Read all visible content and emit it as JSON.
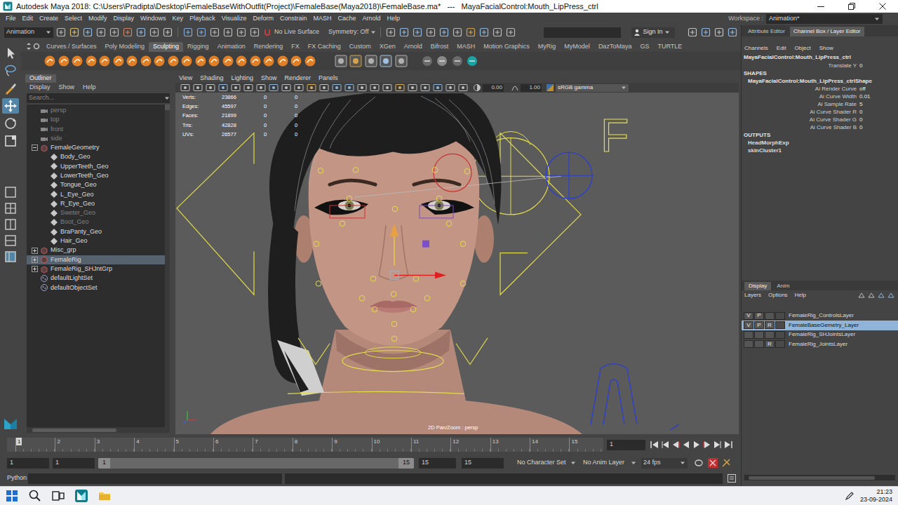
{
  "window": {
    "title": "Autodesk Maya 2018: C:\\Users\\Pradipta\\Desktop\\FemaleBaseWithOutfit(Project)\\FemaleBase(Maya2018)\\FemaleBase.ma*   ---   MayaFacialControl:Mouth_LipPress_ctrl"
  },
  "menu_bar": {
    "items": [
      "File",
      "Edit",
      "Create",
      "Select",
      "Modify",
      "Display",
      "Windows",
      "Key",
      "Playback",
      "Visualize",
      "Deform",
      "Constrain",
      "MASH",
      "Cache",
      "Arnold",
      "Help"
    ],
    "workspace_label": "Workspace :",
    "workspace": "Animation*"
  },
  "status_line": {
    "menu_set": "Animation",
    "live_surface": "No Live Surface",
    "symmetry": "Symmetry: Off",
    "sign_in": "Sign In"
  },
  "shelf": {
    "tabs": [
      {
        "label": "Curves / Surfaces",
        "selected": false
      },
      {
        "label": "Poly Modeling",
        "selected": false
      },
      {
        "label": "Sculpting",
        "selected": true
      },
      {
        "label": "Rigging",
        "selected": false
      },
      {
        "label": "Animation",
        "selected": false
      },
      {
        "label": "Rendering",
        "selected": false
      },
      {
        "label": "FX",
        "selected": false
      },
      {
        "label": "FX Caching",
        "selected": false
      },
      {
        "label": "Custom",
        "selected": false
      },
      {
        "label": "XGen",
        "selected": false
      },
      {
        "label": "Arnold",
        "selected": false
      },
      {
        "label": "Bifrost",
        "selected": false
      },
      {
        "label": "MASH",
        "selected": false
      },
      {
        "label": "Motion Graphics",
        "selected": false
      },
      {
        "label": "MyRig",
        "selected": false
      },
      {
        "label": "MyModel",
        "selected": false
      },
      {
        "label": "DazToMaya",
        "selected": false
      },
      {
        "label": "GS",
        "selected": false
      },
      {
        "label": "TURTLE",
        "selected": false
      }
    ]
  },
  "toolbox": {
    "tools": [
      {
        "kind": "select",
        "selected": false
      },
      {
        "kind": "lasso",
        "selected": false
      },
      {
        "kind": "paint",
        "selected": false
      },
      {
        "kind": "move",
        "selected": true
      },
      {
        "kind": "rotate",
        "selected": false
      },
      {
        "kind": "scale",
        "selected": false
      }
    ]
  },
  "outliner": {
    "title": "Outliner",
    "menus": [
      "Display",
      "Show",
      "Help"
    ],
    "search": {
      "placeholder": "Search..."
    },
    "items": [
      {
        "label": "persp",
        "kind": "camera",
        "dimmed": true,
        "selected": false
      },
      {
        "label": "top",
        "kind": "camera",
        "dimmed": true,
        "selected": false
      },
      {
        "label": "front",
        "kind": "camera",
        "dimmed": true,
        "selected": false
      },
      {
        "label": "side",
        "kind": "camera",
        "dimmed": true,
        "selected": false
      },
      {
        "label": "FemaleGeometry",
        "kind": "group",
        "dimmed": false,
        "selected": false,
        "expanded": true,
        "children": [
          {
            "label": "Body_Geo",
            "kind": "mesh",
            "dimmed": false,
            "selected": false
          },
          {
            "label": "UpperTeeth_Geo",
            "kind": "mesh",
            "dimmed": false,
            "selected": false
          },
          {
            "label": "LowerTeeth_Geo",
            "kind": "mesh",
            "dimmed": false,
            "selected": false
          },
          {
            "label": "Tongue_Geo",
            "kind": "mesh",
            "dimmed": false,
            "selected": false
          },
          {
            "label": "L_Eye_Geo",
            "kind": "mesh",
            "dimmed": false,
            "selected": false
          },
          {
            "label": "R_Eye_Geo",
            "kind": "mesh",
            "dimmed": false,
            "selected": false
          },
          {
            "label": "Sweter_Geo",
            "kind": "mesh",
            "dimmed": true,
            "selected": false
          },
          {
            "label": "Boot_Geo",
            "kind": "mesh",
            "dimmed": true,
            "selected": false
          },
          {
            "label": "BraPanty_Geo",
            "kind": "mesh",
            "dimmed": false,
            "selected": false
          },
          {
            "label": "Hair_Geo",
            "kind": "mesh",
            "dimmed": false,
            "selected": false
          }
        ]
      },
      {
        "label": "Misc_grp",
        "kind": "group",
        "dimmed": false,
        "selected": false,
        "expanded": false
      },
      {
        "label": "FemaleRig",
        "kind": "group",
        "dimmed": false,
        "selected": true,
        "expanded": false
      },
      {
        "label": "FemaleRig_SHJntGrp",
        "kind": "group",
        "dimmed": false,
        "selected": false,
        "expanded": false
      },
      {
        "label": "defaultLightSet",
        "kind": "set",
        "dimmed": false,
        "selected": false
      },
      {
        "label": "defaultObjectSet",
        "kind": "set",
        "dimmed": false,
        "selected": false
      }
    ]
  },
  "viewport": {
    "menus": [
      "View",
      "Shading",
      "Lighting",
      "Show",
      "Renderer",
      "Panels"
    ],
    "exposure": "0.00",
    "gamma": "1.00",
    "color_space": "sRGB gamma",
    "hud": [
      {
        "label": "Verts:",
        "values": [
          "23866",
          "0",
          "0"
        ]
      },
      {
        "label": "Edges:",
        "values": [
          "45597",
          "0",
          "0"
        ]
      },
      {
        "label": "Faces:",
        "values": [
          "21899",
          "0",
          "0"
        ]
      },
      {
        "label": "Tris:",
        "values": [
          "42828",
          "0",
          "0"
        ]
      },
      {
        "label": "UVs:",
        "values": [
          "26577",
          "0",
          "0"
        ]
      }
    ],
    "control_label": "F",
    "camera_label": "2D Pan/Zoom : persp"
  },
  "time_slider": {
    "ticks": [
      {
        "label": "1",
        "current": true
      },
      {
        "label": "2",
        "current": false
      },
      {
        "label": "3",
        "current": false
      },
      {
        "label": "4",
        "current": false
      },
      {
        "label": "5",
        "current": false
      },
      {
        "label": "6",
        "current": false
      },
      {
        "label": "7",
        "current": false
      },
      {
        "label": "8",
        "current": false
      },
      {
        "label": "9",
        "current": false
      },
      {
        "label": "10",
        "current": false
      },
      {
        "label": "11",
        "current": false
      },
      {
        "label": "12",
        "current": false
      },
      {
        "label": "13",
        "current": false
      },
      {
        "label": "14",
        "current": false
      },
      {
        "label": "15",
        "current": false
      }
    ],
    "current_frame": "1"
  },
  "range_slider": {
    "animation_start": "1",
    "playback_start": "1",
    "range_start": "1",
    "range_end": "15",
    "playback_end": "15",
    "animation_end": "15",
    "character_set": "No Character Set",
    "anim_layer": "No Anim Layer",
    "fps": "24 fps"
  },
  "command_line": {
    "language": "Python"
  },
  "channel_box": {
    "tabs": [
      {
        "label": "Attribute Editor",
        "selected": false
      },
      {
        "label": "Channel Box / Layer Editor",
        "selected": true
      }
    ],
    "menus": [
      "Channels",
      "Edit",
      "Object",
      "Show"
    ],
    "node": "MayaFacialControl:Mouth_LipPress_ctrl",
    "channels": [
      {
        "name": "Translate Y",
        "value": "0"
      }
    ],
    "shapes_heading": "SHAPES",
    "shape": "MayaFacialControl:Mouth_LipPress_ctrlShape",
    "shape_attrs": [
      {
        "name": "Ai Render Curve",
        "value": "off"
      },
      {
        "name": "Ai Curve Width",
        "value": "0.01"
      },
      {
        "name": "Ai Sample Rate",
        "value": "5"
      },
      {
        "name": "Ai Curve Shader R",
        "value": "0"
      },
      {
        "name": "Ai Curve Shader G",
        "value": "0"
      },
      {
        "name": "Ai Curve Shader B",
        "value": "0"
      }
    ],
    "outputs_heading": "OUTPUTS",
    "outputs": [
      "HeadMorphExp",
      "skinCluster1"
    ]
  },
  "layer_editor": {
    "tabs": [
      {
        "label": "Display",
        "selected": true
      },
      {
        "label": "Anim",
        "selected": false
      }
    ],
    "menus": [
      "Layers",
      "Options",
      "Help"
    ],
    "layers": [
      {
        "name": "FemaleRig_ControlsLayer",
        "visibility": "V",
        "playback": "P",
        "display_type": "",
        "selected": false
      },
      {
        "name": "FemaleBaseGemetry_Layer",
        "visibility": "V",
        "playback": "P",
        "display_type": "R",
        "selected": true
      },
      {
        "name": "FemaleRig_SHJointsLayer",
        "visibility": "",
        "playback": "",
        "display_type": "",
        "selected": false
      },
      {
        "name": "FemaleRig_JointsLayer",
        "visibility": "",
        "playback": "",
        "display_type": "R",
        "selected": false
      }
    ]
  },
  "taskbar": {
    "time": "21:23",
    "date": "23-09-2024"
  }
}
